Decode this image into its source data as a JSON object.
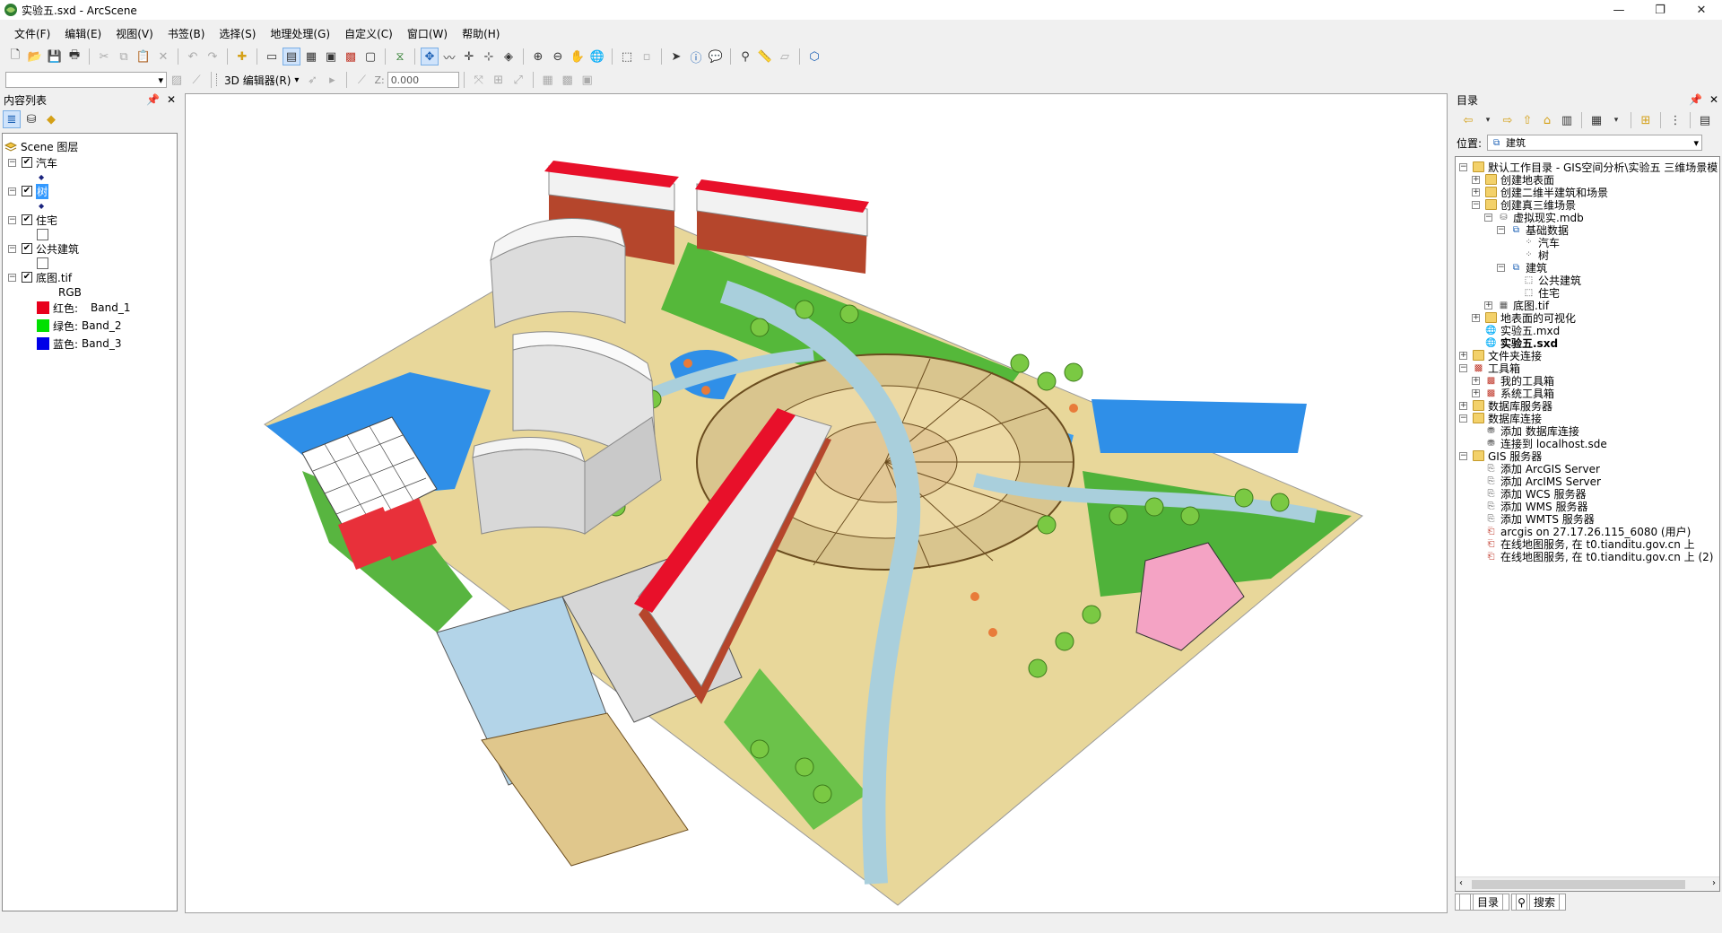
{
  "window": {
    "title": "实验五.sxd - ArcScene"
  },
  "menu": [
    "文件(F)",
    "编辑(E)",
    "视图(V)",
    "书签(B)",
    "选择(S)",
    "地理处理(G)",
    "自定义(C)",
    "窗口(W)",
    "帮助(H)"
  ],
  "toolbar2": {
    "editor_label": "3D 编辑器(R)",
    "z_label": "Z:",
    "z_value": "0.000"
  },
  "toc": {
    "title": "内容列表",
    "root": "Scene 图层",
    "layers": [
      {
        "name": "汽车",
        "symbol": "point"
      },
      {
        "name": "树",
        "symbol": "point",
        "selected": true
      },
      {
        "name": "住宅",
        "symbol": "box"
      },
      {
        "name": "公共建筑",
        "symbol": "box"
      },
      {
        "name": "底图.tif",
        "symbol": "rgb"
      }
    ],
    "rgb_label": "RGB",
    "bands": [
      {
        "label": "红色:",
        "band": "Band_1",
        "color": "#e8001c"
      },
      {
        "label": "绿色:",
        "band": "Band_2",
        "color": "#00e000"
      },
      {
        "label": "蓝色:",
        "band": "Band_3",
        "color": "#0000e8"
      }
    ]
  },
  "catalog": {
    "title": "目录",
    "location_label": "位置:",
    "location_value": "建筑",
    "tree": [
      {
        "t": "默认工作目录 - GIS空间分析\\实验五 三维场景模",
        "d": 0,
        "exp": "-",
        "i": "folder"
      },
      {
        "t": "创建地表面",
        "d": 1,
        "exp": "+",
        "i": "folder"
      },
      {
        "t": "创建二维半建筑和场景",
        "d": 1,
        "exp": "+",
        "i": "folder"
      },
      {
        "t": "创建真三维场景",
        "d": 1,
        "exp": "-",
        "i": "folder"
      },
      {
        "t": "虚拟现实.mdb",
        "d": 2,
        "exp": "-",
        "i": "db"
      },
      {
        "t": "基础数据",
        "d": 3,
        "exp": "-",
        "i": "fds"
      },
      {
        "t": "汽车",
        "d": 4,
        "exp": "",
        "i": "fc"
      },
      {
        "t": "树",
        "d": 4,
        "exp": "",
        "i": "fc"
      },
      {
        "t": "建筑",
        "d": 3,
        "exp": "-",
        "i": "fds"
      },
      {
        "t": "公共建筑",
        "d": 4,
        "exp": "",
        "i": "mp"
      },
      {
        "t": "住宅",
        "d": 4,
        "exp": "",
        "i": "mp"
      },
      {
        "t": "底图.tif",
        "d": 2,
        "exp": "+",
        "i": "raster"
      },
      {
        "t": "地表面的可视化",
        "d": 1,
        "exp": "+",
        "i": "folder"
      },
      {
        "t": "实验五.mxd",
        "d": 1,
        "exp": "",
        "i": "mxd"
      },
      {
        "t": "实验五.sxd",
        "d": 1,
        "exp": "",
        "i": "sxd",
        "bold": true
      },
      {
        "t": "文件夹连接",
        "d": 0,
        "exp": "+",
        "i": "folder"
      },
      {
        "t": "工具箱",
        "d": 0,
        "exp": "-",
        "i": "tbx"
      },
      {
        "t": "我的工具箱",
        "d": 1,
        "exp": "+",
        "i": "tbx"
      },
      {
        "t": "系统工具箱",
        "d": 1,
        "exp": "+",
        "i": "tbx"
      },
      {
        "t": "数据库服务器",
        "d": 0,
        "exp": "+",
        "i": "folder"
      },
      {
        "t": "数据库连接",
        "d": 0,
        "exp": "-",
        "i": "folder"
      },
      {
        "t": "添加 数据库连接",
        "d": 1,
        "exp": "",
        "i": "conn"
      },
      {
        "t": "连接到 localhost.sde",
        "d": 1,
        "exp": "",
        "i": "conn"
      },
      {
        "t": "GIS 服务器",
        "d": 0,
        "exp": "-",
        "i": "folder"
      },
      {
        "t": "添加 ArcGIS Server",
        "d": 1,
        "exp": "",
        "i": "srv"
      },
      {
        "t": "添加 ArcIMS Server",
        "d": 1,
        "exp": "",
        "i": "srv"
      },
      {
        "t": "添加 WCS 服务器",
        "d": 1,
        "exp": "",
        "i": "srv"
      },
      {
        "t": "添加 WMS 服务器",
        "d": 1,
        "exp": "",
        "i": "srv"
      },
      {
        "t": "添加 WMTS 服务器",
        "d": 1,
        "exp": "",
        "i": "srv"
      },
      {
        "t": "arcgis on 27.17.26.115_6080 (用户)",
        "d": 1,
        "exp": "",
        "i": "srv2"
      },
      {
        "t": "在线地图服务, 在 t0.tianditu.gov.cn 上",
        "d": 1,
        "exp": "",
        "i": "srv2"
      },
      {
        "t": "在线地图服务, 在 t0.tianditu.gov.cn 上 (2)",
        "d": 1,
        "exp": "",
        "i": "srv2"
      }
    ],
    "tabs": [
      "目录",
      "搜索"
    ]
  }
}
